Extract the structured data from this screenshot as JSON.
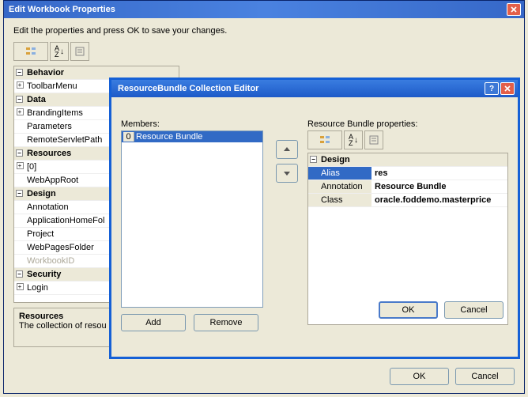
{
  "outer": {
    "title": "Edit Workbook Properties",
    "instruction": "Edit the properties and press OK to save your changes.",
    "categories": {
      "behavior": "Behavior",
      "data": "Data",
      "resources": "Resources",
      "design": "Design",
      "security": "Security"
    },
    "rows": {
      "toolbarMenu": "ToolbarMenu",
      "brandingItems": "BrandingItems",
      "parameters": "Parameters",
      "remoteServletPath": "RemoteServletPath",
      "resItem0": "[0]",
      "webAppRoot": "WebAppRoot",
      "annotation": "Annotation",
      "applicationHomeFolder": "ApplicationHomeFol",
      "project": "Project",
      "webPagesFolder": "WebPagesFolder",
      "workbookID": "WorkbookID",
      "login": "Login"
    },
    "desc": {
      "title": "Resources",
      "text": "The collection of resou"
    },
    "buttons": {
      "ok": "OK",
      "cancel": "Cancel"
    }
  },
  "inner": {
    "title": "ResourceBundle Collection Editor",
    "membersLabel": "Members:",
    "memberIndex": "0",
    "memberName": "Resource Bundle",
    "propsLabel": "Resource Bundle properties:",
    "designHeader": "Design",
    "rows": {
      "aliasName": "Alias",
      "aliasVal": "res",
      "annotationName": "Annotation",
      "annotationVal": "Resource Bundle",
      "className": "Class",
      "classVal": "oracle.foddemo.masterprice"
    },
    "buttons": {
      "add": "Add",
      "remove": "Remove",
      "ok": "OK",
      "cancel": "Cancel"
    }
  }
}
